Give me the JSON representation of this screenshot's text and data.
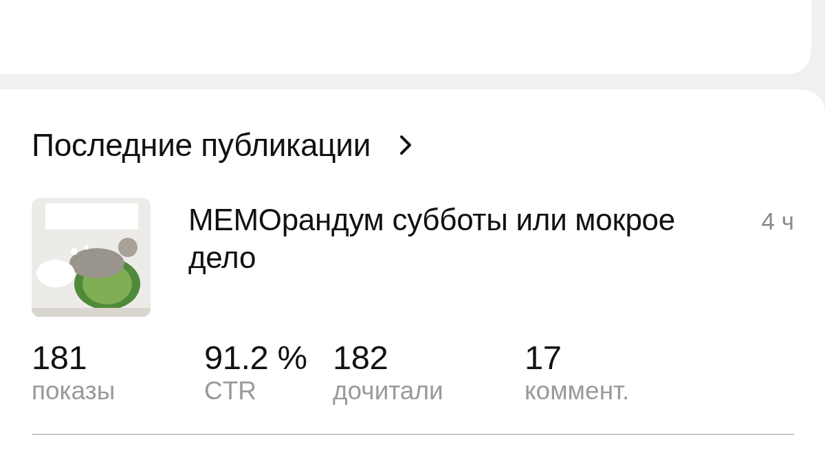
{
  "section": {
    "title": "Последние публикации"
  },
  "publications": [
    {
      "title": "МЕМОрандум субботы или мокрое дело",
      "time": "4 ч",
      "stats": [
        {
          "value": "181",
          "label": "показы"
        },
        {
          "value": "91.2 %",
          "label": "CTR"
        },
        {
          "value": "182",
          "label": "дочитали"
        },
        {
          "value": "17",
          "label": "коммент."
        }
      ]
    }
  ]
}
